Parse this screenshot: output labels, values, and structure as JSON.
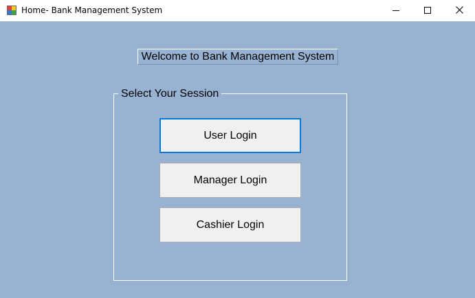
{
  "window": {
    "title": "Home- Bank Management System",
    "controls": {
      "minimize_icon": "minimize-icon",
      "maximize_icon": "maximize-icon",
      "close_icon": "close-icon"
    }
  },
  "main": {
    "welcome_text": "Welcome to Bank Management System",
    "session_group": {
      "legend": "Select Your Session",
      "buttons": [
        {
          "label": "User Login",
          "focused": true
        },
        {
          "label": "Manager Login",
          "focused": false
        },
        {
          "label": "Cashier Login",
          "focused": false
        }
      ]
    }
  },
  "colors": {
    "client_background": "#98b2d2",
    "button_face": "#f0f0f0",
    "focus_border": "#0078d7"
  }
}
